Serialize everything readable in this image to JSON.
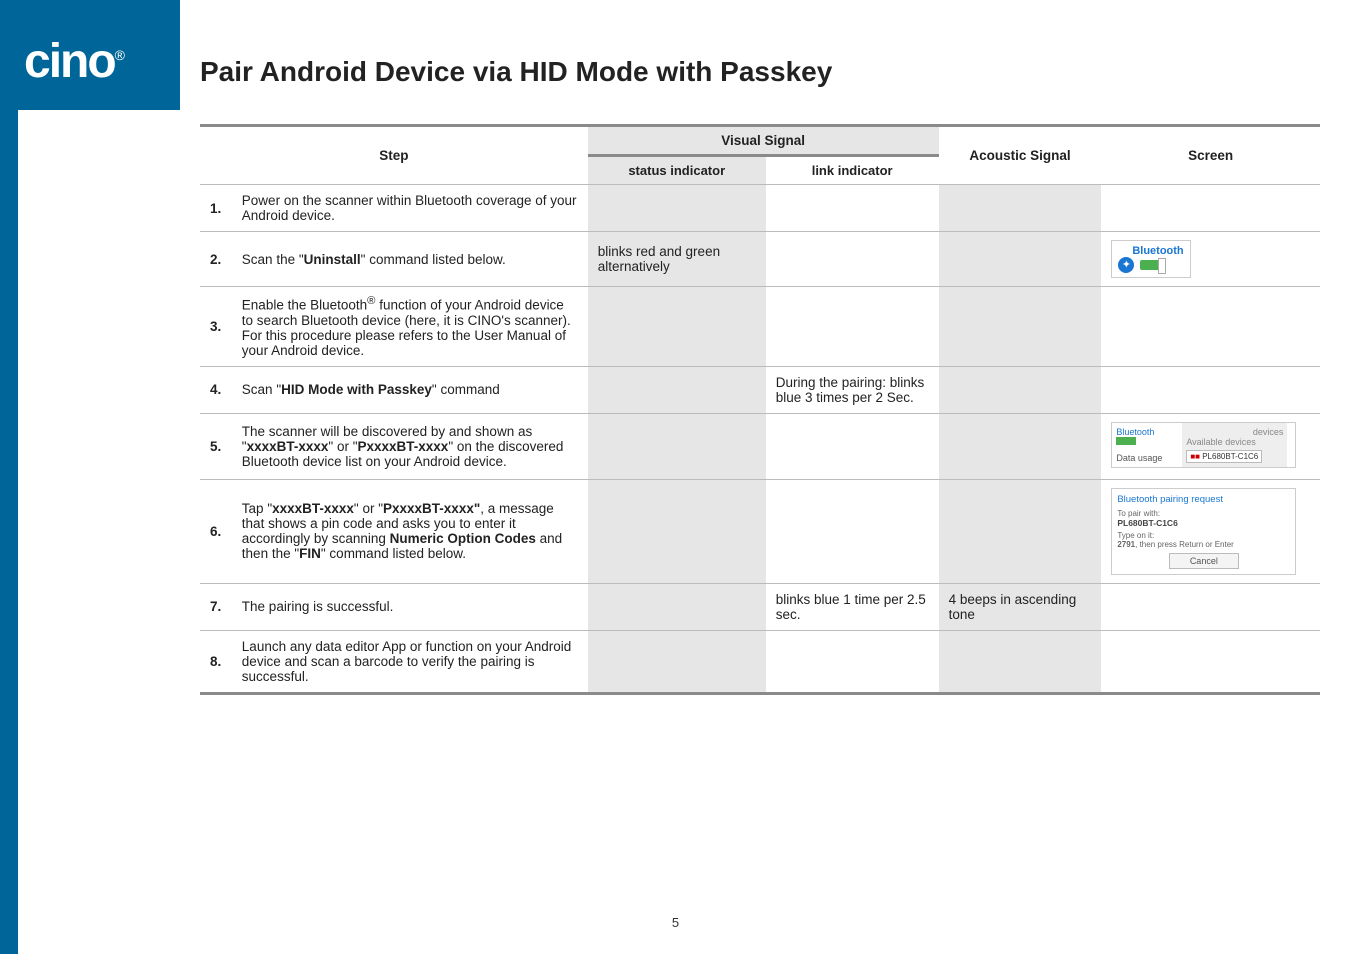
{
  "logo": {
    "text": "cino",
    "reg": "®"
  },
  "title": "Pair Android Device via HID Mode with Passkey",
  "page_number": "5",
  "headers": {
    "step": "Step",
    "visual": "Visual Signal",
    "status": "status indicator",
    "link": "link indicator",
    "acoustic": "Acoustic Signal",
    "screen": "Screen"
  },
  "rows": [
    {
      "num": "1.",
      "step_html": "Power on the scanner within Bluetooth coverage of your Android device.",
      "status": "",
      "link": "",
      "acoustic": "",
      "screen": ""
    },
    {
      "num": "2.",
      "step_html": "Scan the \"<b>Uninstall</b>\" command listed below.",
      "status": "blinks red and green alternatively",
      "link": "",
      "acoustic": "",
      "screen_type": "bt_toggle"
    },
    {
      "num": "3.",
      "step_html": "Enable the Bluetooth<sup>®</sup> function of your Android device to search Bluetooth device (here, it is CINO's scanner).<br>For this procedure please refers to the User Manual of your Android device.",
      "status": "",
      "link": "",
      "acoustic": "",
      "screen": ""
    },
    {
      "num": "4.",
      "step_html": "Scan \"<b>HID Mode with Passkey</b>\" command",
      "status": "",
      "link": "During the pairing: blinks blue 3 times per 2 Sec.",
      "acoustic": "",
      "screen": ""
    },
    {
      "num": "5.",
      "step_html": "The scanner will be discovered by and shown as \"<b>xxxxBT-xxxx</b>\" or \"<b>PxxxxBT-xxxx</b>\" on the discovered Bluetooth device list on your Android device.",
      "status": "",
      "link": "",
      "acoustic": "",
      "screen_type": "devices"
    },
    {
      "num": "6.",
      "step_html": "Tap \"<b>xxxxBT-xxxx</b>\" or \"<b>PxxxxBT-xxxx\"</b>, a message that shows a pin code and asks you to enter it accordingly by scanning <b>Numeric Option Codes</b> and then the \"<b>FIN</b>\" command listed below.",
      "status": "",
      "link": "",
      "acoustic": "",
      "screen_type": "pair_request"
    },
    {
      "num": "7.",
      "step_html": "The pairing is successful.",
      "status": "",
      "link": "blinks blue 1 time per 2.5 sec.",
      "acoustic": "4 beeps in ascending tone",
      "screen": ""
    },
    {
      "num": "8.",
      "step_html": "Launch any data editor App or function on your Android device and scan a barcode to verify the pairing is successful.",
      "status": "",
      "link": "",
      "acoustic": "",
      "screen": ""
    }
  ],
  "screenshots": {
    "bt_toggle": {
      "label": "Bluetooth"
    },
    "devices": {
      "left_bt": "Bluetooth",
      "left_data": "Data usage",
      "right_head": "devices",
      "right_avail": "Available devices",
      "device_name": "PL680BT-C1C6"
    },
    "pair_request": {
      "header": "Bluetooth pairing request",
      "to_pair_label": "To pair with:",
      "to_pair_value": "PL680BT-C1C6",
      "type_label": "Type on it:",
      "type_value": "2791",
      "type_suffix": ", then press Return or Enter",
      "cancel": "Cancel"
    }
  }
}
